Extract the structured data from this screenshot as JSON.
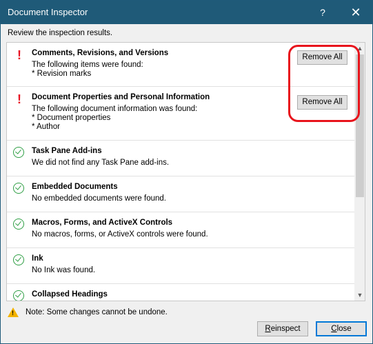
{
  "window": {
    "title": "Document Inspector",
    "help_glyph": "?",
    "close_glyph": "✕"
  },
  "subtitle": "Review the inspection results.",
  "results": [
    {
      "heading": "Comments, Revisions, and Versions",
      "status": "issues-found",
      "lines": [
        "The following items were found:",
        "* Revision marks"
      ],
      "action": "Remove All"
    },
    {
      "heading": "Document Properties and Personal Information",
      "status": "issues-found",
      "lines": [
        "The following document information was found:",
        "* Document properties",
        "* Author"
      ],
      "action": "Remove All"
    },
    {
      "heading": "Task Pane Add-ins",
      "status": "ok",
      "lines": [
        "We did not find any Task Pane add-ins."
      ]
    },
    {
      "heading": "Embedded Documents",
      "status": "ok",
      "lines": [
        "No embedded documents were found."
      ]
    },
    {
      "heading": "Macros, Forms, and ActiveX Controls",
      "status": "ok",
      "lines": [
        "No macros, forms, or ActiveX controls were found."
      ]
    },
    {
      "heading": "Ink",
      "status": "ok",
      "lines": [
        "No Ink was found."
      ]
    },
    {
      "heading": "Collapsed Headings",
      "status": "ok",
      "lines": []
    }
  ],
  "issue_glyph": "!",
  "scroll": {
    "up_glyph": "▲",
    "down_glyph": "▼"
  },
  "note": {
    "icon_glyph": "!",
    "text": "Note: Some changes cannot be undone."
  },
  "buttons": {
    "reinspect_prefix": "R",
    "reinspect_rest": "einspect",
    "close_prefix": "C",
    "close_rest": "lose"
  },
  "colors": {
    "titlebar": "#1f5a78",
    "issue": "#e81123",
    "ok": "#2e9e44",
    "highlight": "#e8141c"
  }
}
